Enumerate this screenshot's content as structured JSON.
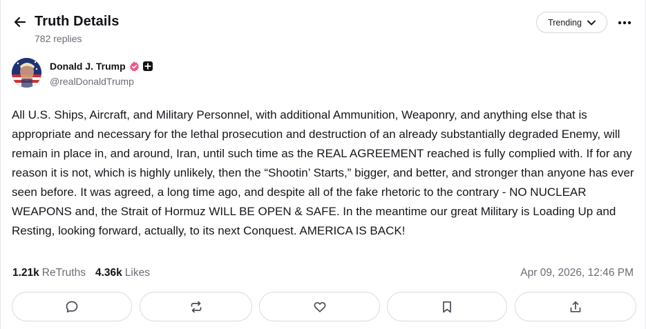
{
  "header": {
    "title": "Truth Details",
    "replies": "782 replies",
    "sort_label": "Trending",
    "back_icon": "arrow-left-icon",
    "more_icon": "more-horizontal-icon"
  },
  "author": {
    "name": "Donald J. Trump",
    "handle": "@realDonaldTrump",
    "verified_color": "#e85a8a"
  },
  "post": {
    "text": "All U.S. Ships, Aircraft, and Military Personnel, with additional Ammunition, Weaponry, and anything else that is appropriate and necessary for the lethal prosecution and destruction of an already substantially degraded Enemy, will remain in place in, and around, Iran, until such time as the REAL AGREEMENT reached is fully complied with. If for any reason it is not, which is highly unlikely, then the “Shootin’ Starts,” bigger, and better, and stronger than anyone has ever seen before. It was agreed, a long time ago, and despite all of the fake rhetoric to the contrary - NO NUCLEAR WEAPONS and, the Strait of Hormuz WILL BE OPEN & SAFE. In the meantime our great Military is Loading Up and Resting, looking forward, actually, to its next Conquest. AMERICA IS BACK!",
    "retruths_count": "1.21k",
    "retruths_label": "ReTruths",
    "likes_count": "4.36k",
    "likes_label": "Likes",
    "timestamp": "Apr 09, 2026, 12:46 PM"
  },
  "actions": [
    {
      "name": "reply",
      "icon": "comment-icon"
    },
    {
      "name": "retruth",
      "icon": "repost-icon"
    },
    {
      "name": "like",
      "icon": "heart-icon"
    },
    {
      "name": "bookmark",
      "icon": "bookmark-icon"
    },
    {
      "name": "share",
      "icon": "share-icon"
    }
  ]
}
